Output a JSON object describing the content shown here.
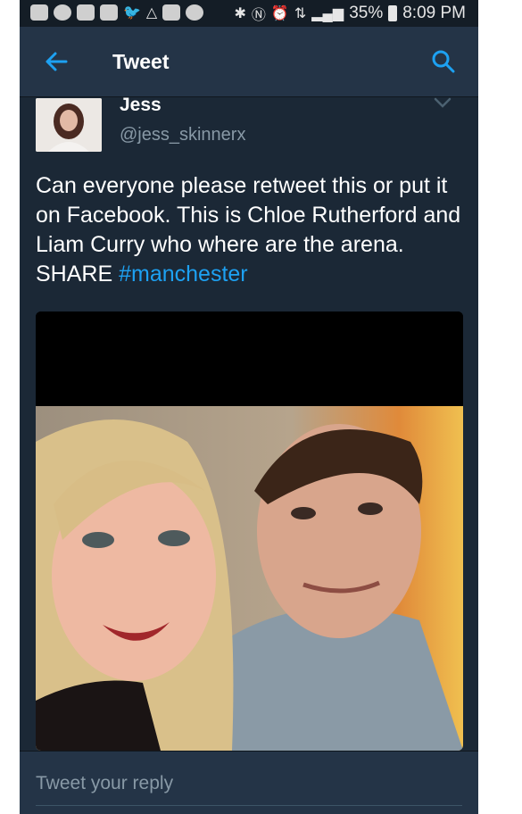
{
  "status_bar": {
    "time": "8:09 PM",
    "battery": "35%",
    "left_icons": [
      "message-icon",
      "spotify-icon",
      "instagram-icon",
      "facebook-icon",
      "twitter-icon",
      "drive-icon",
      "instagram-icon",
      "spiral-icon"
    ],
    "right_icons": [
      "bluetooth-icon",
      "nfc-icon",
      "alarm-icon",
      "data-icon",
      "signal-icon"
    ]
  },
  "header": {
    "title": "Tweet",
    "back_icon": "back-arrow-icon",
    "search_icon": "search-icon"
  },
  "tweet": {
    "author_name": "Jess",
    "author_handle": "@jess_skinnerx",
    "text_main": "Can everyone please retweet this or put it on Facebook. This is Chloe Rutherford and Liam Curry who where are the arena. SHARE ",
    "hashtag": "#manchester"
  },
  "reply": {
    "placeholder": "Tweet your reply"
  },
  "colors": {
    "background": "#1b2836",
    "header": "#243447",
    "accent": "#1da1f2",
    "secondary_text": "#8899a6"
  }
}
